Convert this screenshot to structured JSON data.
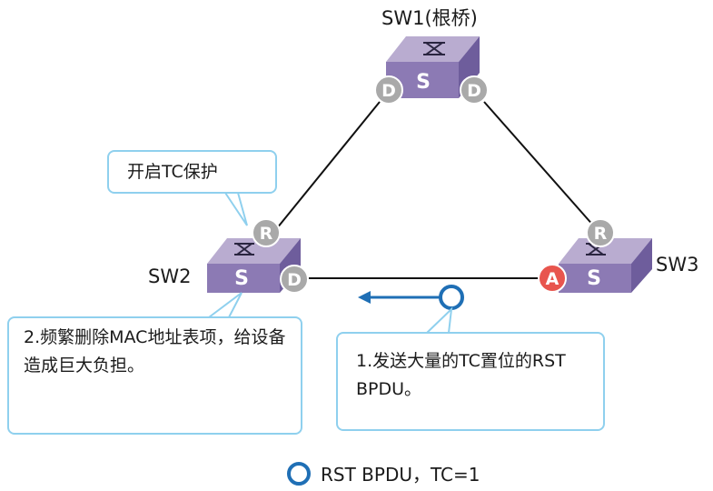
{
  "switches": {
    "sw1_label": "SW1(根桥)",
    "sw2_label": "SW2",
    "sw3_label": "SW3",
    "device_letter": "S"
  },
  "port_roles": {
    "designated": "D",
    "root": "R",
    "alternate": "A"
  },
  "callouts": {
    "tc_protection": "开启TC保护",
    "mac_flush": "2.频繁删除MAC地址表项，给设备造成巨大负担。",
    "send_bpdu": "1.发送大量的TC置位的RST BPDU。"
  },
  "legend": {
    "text": "RST BPDU，TC=1"
  },
  "colors": {
    "switch_top": "#b9acd0",
    "switch_front": "#8c7ab4",
    "switch_side": "#6e5d9c",
    "port_gray": "#a9a9a9",
    "port_red": "#e8554e",
    "arrow_blue": "#1f6fb5",
    "callout_border": "#8fd0ee"
  }
}
